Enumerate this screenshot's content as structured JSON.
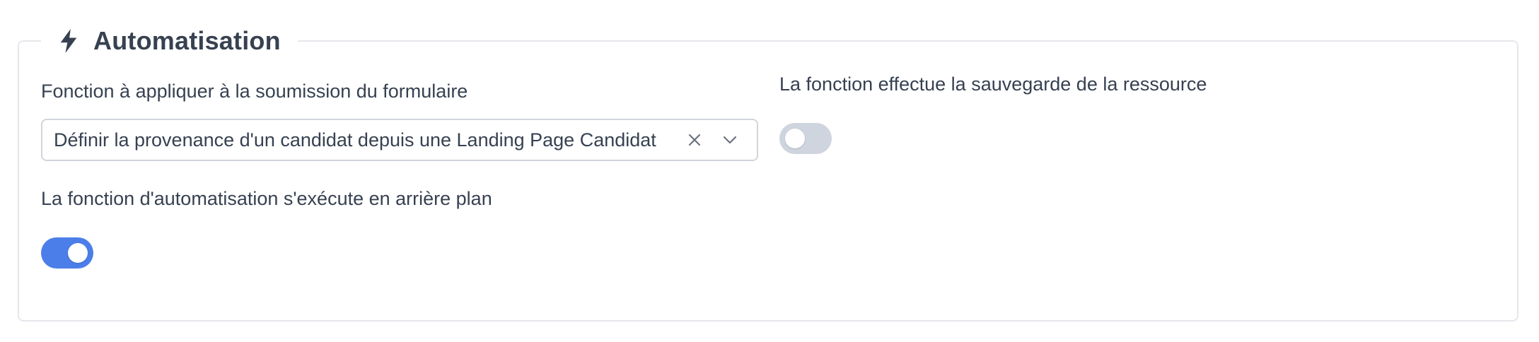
{
  "section": {
    "title": "Automatisation",
    "icon": "bolt-icon"
  },
  "fields": {
    "function": {
      "label": "Fonction à appliquer à la soumission du formulaire",
      "value": "Définir la provenance d'un candidat depuis une Landing Page Candidat",
      "clear_icon": "close-icon",
      "dropdown_icon": "chevron-down-icon"
    },
    "save_resource": {
      "label": "La fonction effectue la sauvegarde de la ressource",
      "enabled": false
    },
    "background": {
      "label": "La fonction d'automatisation s'exécute en arrière plan",
      "enabled": true
    }
  },
  "colors": {
    "toggle_on": "#4b7ee8",
    "toggle_off": "#cfd5de",
    "text": "#374151",
    "border": "#e5e7eb"
  }
}
